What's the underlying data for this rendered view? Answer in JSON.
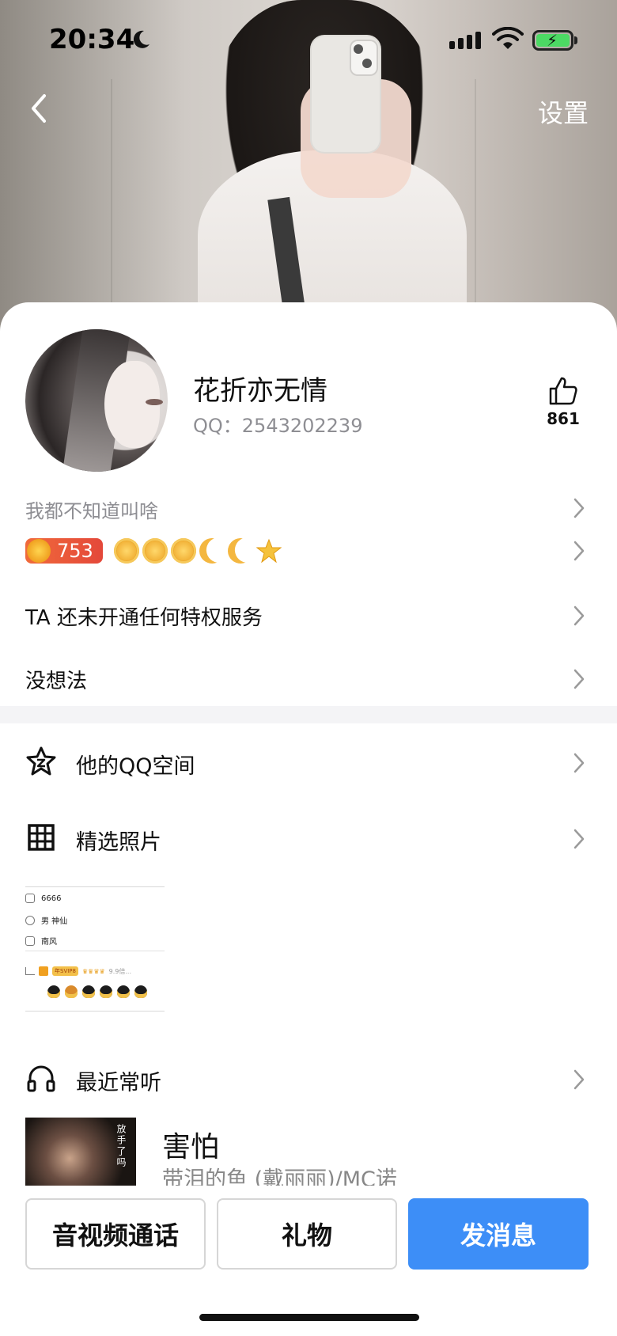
{
  "status_bar": {
    "time": "20:34",
    "icons": [
      "moon-icon",
      "signal-icon",
      "wifi-icon",
      "battery-charging-icon"
    ]
  },
  "header": {
    "back_icon": "chevron-left-icon",
    "settings_label": "设置"
  },
  "profile": {
    "nickname": "花折亦无情",
    "qq_label": "QQ：2543202239",
    "like_icon": "thumbs-up-icon",
    "like_count": "861"
  },
  "signature": "我都不知道叫啥",
  "level": {
    "value": "753",
    "icons": [
      "sun-icon",
      "sun-icon",
      "sun-icon",
      "moon-icon",
      "moon-icon",
      "star-icon"
    ]
  },
  "privilege_text": "TA 还未开通任何特权服务",
  "idea_text": "没想法",
  "menu": {
    "zone": {
      "label": "他的QQ空间",
      "icon": "qzone-star-icon"
    },
    "photos": {
      "label": "精选照片",
      "icon": "grid-icon"
    },
    "music": {
      "label": "最近常听",
      "icon": "headphones-icon"
    }
  },
  "photo_thumb": {
    "line1": "6666",
    "line2": "男  神仙",
    "line3": "南风",
    "vip_label": "年SVIP8",
    "multiplier": "9.9倍..."
  },
  "song": {
    "title": "害怕",
    "artist": "带泪的鱼 (戴丽丽)/MC诺",
    "cover_text": "放手了吗"
  },
  "actions": {
    "call": "音视频通话",
    "gift": "礼物",
    "message": "发消息"
  },
  "colors": {
    "primary": "#3d8ef7",
    "level_badge": "#e4483a",
    "muted_text": "#8e8e93"
  }
}
